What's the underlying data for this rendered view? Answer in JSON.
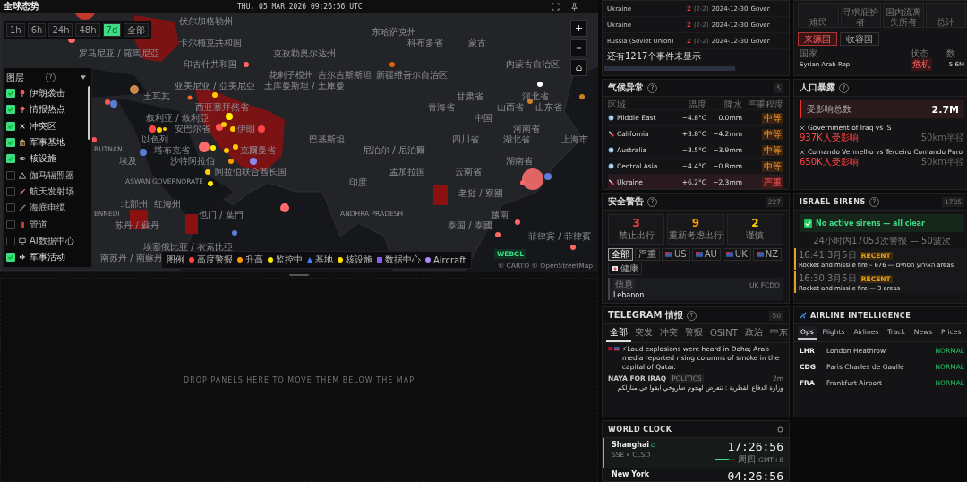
{
  "header": {
    "title": "全球态势",
    "datetime": "THU, 05 MAR 2026 09:26:56 UTC"
  },
  "time_filters": [
    {
      "label": "1h",
      "selected": false
    },
    {
      "label": "6h",
      "selected": false
    },
    {
      "label": "24h",
      "selected": false
    },
    {
      "label": "48h",
      "selected": false
    },
    {
      "label": "7d",
      "selected": true
    },
    {
      "label": "全部",
      "selected": false
    }
  ],
  "layers": {
    "title": "图层",
    "help": "?",
    "items": [
      {
        "label": "伊朗袭击",
        "checked": true
      },
      {
        "label": "情报热点",
        "checked": true
      },
      {
        "label": "冲突区",
        "checked": true
      },
      {
        "label": "军事基地",
        "checked": true
      },
      {
        "label": "核设施",
        "checked": true
      },
      {
        "label": "伽马辐照器",
        "checked": false
      },
      {
        "label": "航天发射场",
        "checked": false
      },
      {
        "label": "海底电缆",
        "checked": false
      },
      {
        "label": "管道",
        "checked": false
      },
      {
        "label": "AI数据中心",
        "checked": false
      },
      {
        "label": "军事活动",
        "checked": true
      }
    ]
  },
  "map_labels": [
    "伏尔加格勒州",
    "东哈萨克州",
    "卡尔梅克共和国",
    "科布多省",
    "蒙古",
    "罗马尼亚 / 羅馬尼亞",
    "克孜勒奥尔达州",
    "印古什共和国",
    "内蒙古自治区",
    "花剌子模州",
    "吉尔吉斯斯坦",
    "新疆维吾尔自治区",
    "亚美尼亚 / 亞美尼亞",
    "土库曼斯坦 / 土庫曼",
    "土耳其",
    "甘肃省",
    "河北省",
    "西亚塞拜然省",
    "青海省",
    "山西省",
    "山东省",
    "叙利亚 / 敘利亞",
    "中国",
    "安巴尔省",
    "伊朗",
    "河南省",
    "以色列",
    "巴基斯坦",
    "四川省",
    "湖北省",
    "上海市",
    "BUTNAN",
    "塔布克省",
    "克爾曼省",
    "尼泊尔 / 尼泊爾",
    "埃及",
    "沙特阿拉伯",
    "湖南省",
    "阿拉伯联合酋长国",
    "孟加拉国",
    "云南省",
    "ASWAN GOVERNORATE",
    "印度",
    "老挝 / 寮國",
    "北部州",
    "红海州",
    "ENNEDI",
    "也门 / 葉門",
    "ANDHRA PRADESH",
    "越南",
    "苏丹 / 蘇丹",
    "泰国 / 泰國",
    "菲律宾 / 菲律賓",
    "埃塞俄比亚 / 衣索比亞",
    "南苏丹 / 南蘇丹"
  ],
  "legend": {
    "title": "图例",
    "items": [
      {
        "label": "高度警报",
        "color": "#ff4444",
        "kind": "dot"
      },
      {
        "label": "升高",
        "color": "#ff9900",
        "kind": "dot"
      },
      {
        "label": "监控中",
        "color": "#ffee00",
        "kind": "dot"
      },
      {
        "label": "基地",
        "color": "#3b82f6",
        "kind": "triangle"
      },
      {
        "label": "核设施",
        "color": "#ffdd00",
        "kind": "dot"
      },
      {
        "label": "数据中心",
        "color": "#8b5cf6",
        "kind": "square"
      },
      {
        "label": "Aircraft",
        "color": "#a78bfa",
        "kind": "dot"
      }
    ]
  },
  "map_badge": "WEBGL",
  "attribution": "© CARTO © OpenStreetMap",
  "events_table": {
    "rows": [
      {
        "country": "Ukraine",
        "count": "2",
        "range": "(2-2)",
        "date": "2024-12-30",
        "column_4": "Gover"
      },
      {
        "country": "Ukraine",
        "count": "2",
        "range": "(2-2)",
        "date": "2024-12-30",
        "column_4": "Gover"
      },
      {
        "country": "Russia (Soviet Union)",
        "count": "2",
        "range": "(2-2)",
        "date": "2024-12-30",
        "column_4": "Gover"
      }
    ],
    "more": "还有1217个事件未显示"
  },
  "displacement": {
    "stats": [
      "难民",
      "寻求庇护者",
      "国内流离失所者",
      "总计"
    ],
    "tabs": [
      {
        "label": "来源国",
        "selected": true
      },
      {
        "label": "收容国",
        "selected": false
      }
    ],
    "columns": [
      "国家",
      "状态",
      "数"
    ],
    "rows": [
      {
        "country": "Syrian Arab Rep.",
        "status": "危机",
        "value": "5.6M"
      }
    ]
  },
  "climate": {
    "title": "气候异常",
    "help": "?",
    "count": "5",
    "columns": [
      "区域",
      "温度",
      "降水",
      "严重程度"
    ],
    "rows": [
      {
        "region": "Middle East",
        "kind": "cold",
        "temp": "−4.8°C",
        "precip": "0.0mm",
        "severe": false,
        "severity_label": "中等"
      },
      {
        "region": "California",
        "kind": "warm",
        "temp": "+3.8°C",
        "precip": "−4.2mm",
        "severe": false,
        "severity_label": "中等"
      },
      {
        "region": "Australia",
        "kind": "cold",
        "temp": "−3.5°C",
        "precip": "−3.9mm",
        "severe": false,
        "severity_label": "中等"
      },
      {
        "region": "Central Asia",
        "kind": "cold",
        "temp": "−4.4°C",
        "precip": "−0.8mm",
        "severe": false,
        "severity_label": "中等"
      },
      {
        "region": "Ukraine",
        "kind": "warm",
        "temp": "+6.2°C",
        "precip": "−2.3mm",
        "severe": true,
        "severity_label": "严重"
      }
    ]
  },
  "population": {
    "title": "人口暴露",
    "help": "?",
    "total_label": "受影响总数",
    "total": "2.7M",
    "items": [
      {
        "name": "Government of Iraq vs IS",
        "affected": "937K人受影响",
        "radius": "50km半径"
      },
      {
        "name": "Comando Vermelho vs Terceiro Comando Puro",
        "affected": "650K人受影响",
        "radius": "50km半径"
      }
    ]
  },
  "security": {
    "title": "安全警告",
    "help": "?",
    "count": "227",
    "stats": [
      {
        "value": "3",
        "label": "禁止出行",
        "color": "#ff4444"
      },
      {
        "value": "9",
        "label": "重新考虑出行",
        "color": "#ff9900"
      },
      {
        "value": "2",
        "label": "谨慎",
        "color": "#ffcc00"
      }
    ],
    "filters": [
      {
        "label": "全部",
        "kind": "plain",
        "selected": true
      },
      {
        "label": "严重",
        "kind": "plain",
        "selected": false
      },
      {
        "label": "US",
        "kind": "flag",
        "selected": false
      },
      {
        "label": "AU",
        "kind": "flag",
        "selected": false
      },
      {
        "label": "UK",
        "kind": "flag",
        "selected": false
      },
      {
        "label": "NZ",
        "kind": "flag",
        "selected": false
      },
      {
        "label": "健康",
        "kind": "health",
        "selected": false
      }
    ],
    "advisory": {
      "tag": "信息",
      "source": "UK FCDO",
      "country": "Lebanon"
    }
  },
  "sirens": {
    "title": "ISRAEL SIRENS",
    "help": "?",
    "count": "1705",
    "status": "No active sirens — all clear",
    "summary": "24小时内17053次警报 — 50波次",
    "items": [
      {
        "time": "16:41 3月5日",
        "badge": "RECENT",
        "text": "Rocket and missile fire – 676 — האירוע הסתיים areas"
      },
      {
        "time": "16:30 3月5日",
        "badge": "RECENT",
        "text": "Rocket and missile fire — 3 areas"
      }
    ]
  },
  "telegram": {
    "title": "TELEGRAM 情报",
    "help": "?",
    "count": "50",
    "tabs": [
      {
        "label": "全部",
        "selected": true
      },
      {
        "label": "突发",
        "selected": false
      },
      {
        "label": "冲突",
        "selected": false
      },
      {
        "label": "警报",
        "selected": false
      },
      {
        "label": "OSINT",
        "selected": false
      },
      {
        "label": "政治",
        "selected": false
      },
      {
        "label": "中东",
        "selected": false
      }
    ],
    "messages": [
      {
        "text": "⚡Loud explosions were heard in Doha; Arab media reported rising columns of smoke in the capital of Qatar."
      },
      {
        "source": "NAYA FOR IRAQ",
        "tag": "POLITICS",
        "age": "2m",
        "text": "وزارة الدفاع القطرية : نتعرض لهجوم صاروخي ابقوا في منازلكم"
      }
    ]
  },
  "airline": {
    "title": "AIRLINE INTELLIGENCE",
    "tabs": [
      {
        "label": "Ops",
        "selected": true
      },
      {
        "label": "Flights",
        "selected": false
      },
      {
        "label": "Airlines",
        "selected": false
      },
      {
        "label": "Track",
        "selected": false
      },
      {
        "label": "News",
        "selected": false
      },
      {
        "label": "Prices",
        "selected": false
      }
    ],
    "airports": [
      {
        "code": "LHR",
        "name": "London Heathrow",
        "status": "NORMAL"
      },
      {
        "code": "CDG",
        "name": "Paris Charles de Gaulle",
        "status": "NORMAL"
      },
      {
        "code": "FRA",
        "name": "Frankfurt Airport",
        "status": "NORMAL"
      }
    ]
  },
  "world_clock": {
    "title": "WORLD CLOCK",
    "clocks": [
      {
        "city": "Shanghai",
        "exchange": "SSE",
        "status": "CLSD",
        "time": "17:26:56",
        "day": "周四",
        "tz": "GMT+8",
        "level": 0.7,
        "selected": true
      },
      {
        "city": "New York",
        "time": "04:26:56",
        "selected": false
      }
    ]
  },
  "drop_zone": "DROP PANELS HERE TO MOVE THEM BELOW THE MAP"
}
